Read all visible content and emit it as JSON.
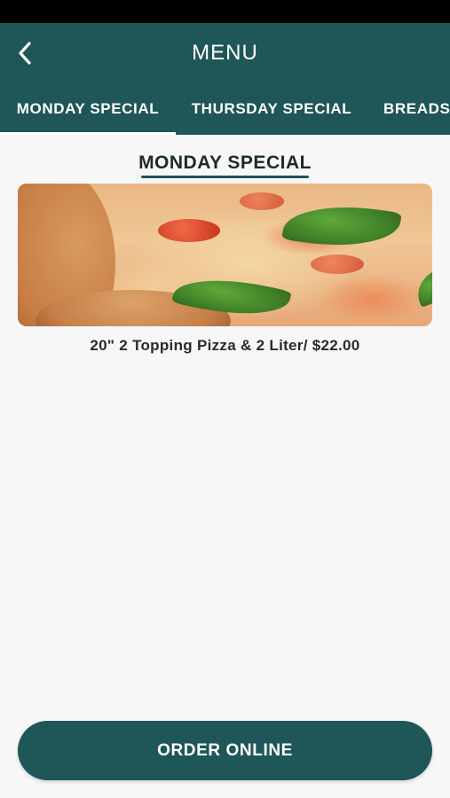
{
  "header": {
    "title": "MENU",
    "back_icon": "chevron-left-icon"
  },
  "tabs": [
    {
      "label": "MONDAY SPECIAL",
      "active": true
    },
    {
      "label": "THURSDAY SPECIAL",
      "active": false
    },
    {
      "label": "BREADSTICKS",
      "active": false
    }
  ],
  "section": {
    "title": "MONDAY SPECIAL",
    "image_alt": "pizza-image",
    "caption": "20\" 2 Topping Pizza & 2 Liter/ $22.00"
  },
  "footer": {
    "order_label": "ORDER ONLINE"
  },
  "colors": {
    "primary": "#1f5657",
    "background": "#f7f7f7",
    "text_dark": "#2b2b2b"
  }
}
